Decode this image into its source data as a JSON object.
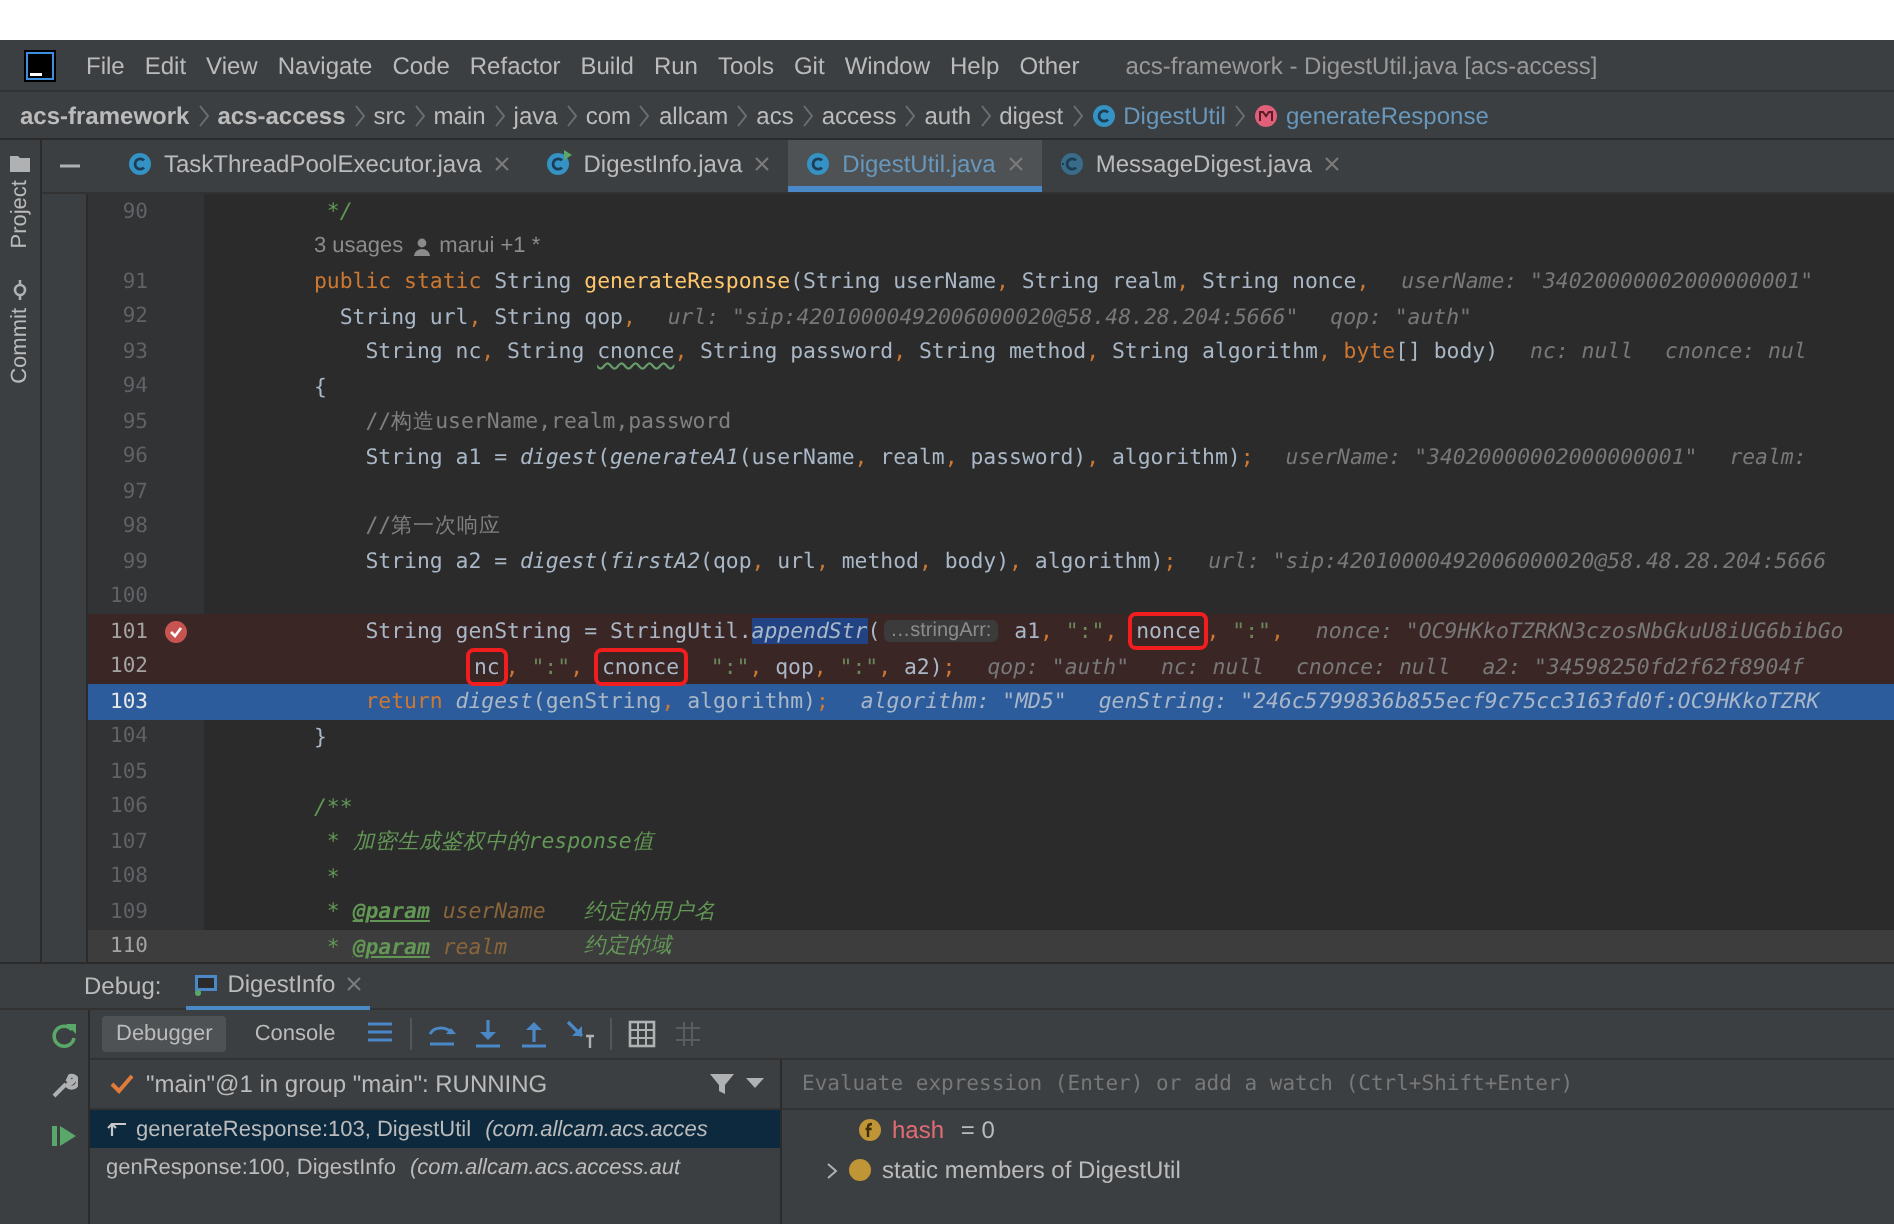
{
  "menu_bar": {
    "items": [
      "File",
      "Edit",
      "View",
      "Navigate",
      "Code",
      "Refactor",
      "Build",
      "Run",
      "Tools",
      "Git",
      "Window",
      "Help",
      "Other"
    ],
    "title": "acs-framework - DigestUtil.java [acs-access]"
  },
  "breadcrumb": [
    {
      "label": "acs-framework",
      "kind": "project"
    },
    {
      "label": "acs-access",
      "kind": "project"
    },
    {
      "label": "src",
      "kind": "folder"
    },
    {
      "label": "main",
      "kind": "folder"
    },
    {
      "label": "java",
      "kind": "folder"
    },
    {
      "label": "com",
      "kind": "folder"
    },
    {
      "label": "allcam",
      "kind": "folder"
    },
    {
      "label": "acs",
      "kind": "folder"
    },
    {
      "label": "access",
      "kind": "folder"
    },
    {
      "label": "auth",
      "kind": "folder"
    },
    {
      "label": "digest",
      "kind": "folder"
    },
    {
      "label": "DigestUtil",
      "kind": "class"
    },
    {
      "label": "generateResponse",
      "kind": "method"
    }
  ],
  "side_tools": [
    {
      "label": "Project",
      "kind": "project"
    },
    {
      "label": "Commit",
      "kind": "commit"
    }
  ],
  "editor_tabs": [
    {
      "label": "TaskThreadPoolExecutor.java",
      "kind": "class",
      "selected": false
    },
    {
      "label": "DigestInfo.java",
      "kind": "running",
      "selected": false
    },
    {
      "label": "DigestUtil.java",
      "kind": "class",
      "selected": true
    },
    {
      "label": "MessageDigest.java",
      "kind": "abstract",
      "selected": false
    }
  ],
  "code_lines": [
    {
      "kind": "code",
      "number": "90",
      "in_breakpoint": false,
      "stopped": false,
      "caret": false,
      "breakpoint": false,
      "tokens": [
        {
          "t": " */",
          "kind": "doc"
        }
      ]
    },
    {
      "kind": "inlay",
      "usages": "3 usages",
      "author": "marui +1 *"
    },
    {
      "kind": "code",
      "number": "91",
      "in_breakpoint": false,
      "stopped": false,
      "caret": false,
      "breakpoint": false,
      "tokens": [
        {
          "t": "public static ",
          "kind": "kw"
        },
        {
          "t": "String ",
          "kind": "p"
        },
        {
          "t": "generateResponse",
          "kind": "fn"
        },
        {
          "t": "(String userName",
          "kind": "p"
        },
        {
          "t": ",",
          "kind": "kw"
        },
        {
          "t": " String realm",
          "kind": "p"
        },
        {
          "t": ",",
          "kind": "kw"
        },
        {
          "t": " String nonce",
          "kind": "p"
        },
        {
          "t": ",",
          "kind": "kw"
        },
        {
          "t": "userName: \"34020000002000000001\"",
          "kind": "hint"
        }
      ]
    },
    {
      "kind": "code",
      "number": "92",
      "in_breakpoint": false,
      "stopped": false,
      "caret": false,
      "breakpoint": false,
      "tokens": [
        {
          "t": "  String url",
          "kind": "p"
        },
        {
          "t": ",",
          "kind": "kw"
        },
        {
          "t": " String qop",
          "kind": "p"
        },
        {
          "t": ",",
          "kind": "kw"
        },
        {
          "t": "url: \"sip:42010000492006000020@58.48.28.204:5666\"",
          "kind": "hint"
        },
        {
          "t": "qop: \"auth\"",
          "kind": "hint"
        }
      ]
    },
    {
      "kind": "code",
      "number": "93",
      "in_breakpoint": false,
      "stopped": false,
      "caret": false,
      "breakpoint": false,
      "tokens": [
        {
          "t": "    String nc",
          "kind": "p"
        },
        {
          "t": ",",
          "kind": "kw"
        },
        {
          "t": " String ",
          "kind": "p"
        },
        {
          "t": "cnonce",
          "kind": "typo"
        },
        {
          "t": ",",
          "kind": "kw"
        },
        {
          "t": " String password",
          "kind": "p"
        },
        {
          "t": ",",
          "kind": "kw"
        },
        {
          "t": " String method",
          "kind": "p"
        },
        {
          "t": ",",
          "kind": "kw"
        },
        {
          "t": " String algorithm",
          "kind": "p"
        },
        {
          "t": ",",
          "kind": "kw"
        },
        {
          "t": " byte",
          "kind": "kw"
        },
        {
          "t": "[] body)",
          "kind": "p"
        },
        {
          "t": "nc: null",
          "kind": "hint"
        },
        {
          "t": "cnonce: nul",
          "kind": "hint"
        }
      ]
    },
    {
      "kind": "code",
      "number": "94",
      "in_breakpoint": false,
      "stopped": false,
      "caret": false,
      "breakpoint": false,
      "tokens": [
        {
          "t": "{",
          "kind": "p"
        }
      ]
    },
    {
      "kind": "code",
      "number": "95",
      "in_breakpoint": false,
      "stopped": false,
      "caret": false,
      "breakpoint": false,
      "tokens": [
        {
          "t": "    //构造userName,realm,password",
          "kind": "cm"
        }
      ]
    },
    {
      "kind": "code",
      "number": "96",
      "in_breakpoint": false,
      "stopped": false,
      "caret": false,
      "breakpoint": false,
      "tokens": [
        {
          "t": "    String a1 = ",
          "kind": "p"
        },
        {
          "t": "digest",
          "kind": "it"
        },
        {
          "t": "(",
          "kind": "p"
        },
        {
          "t": "generateA1",
          "kind": "it"
        },
        {
          "t": "(userName",
          "kind": "p"
        },
        {
          "t": ",",
          "kind": "kw"
        },
        {
          "t": " realm",
          "kind": "p"
        },
        {
          "t": ",",
          "kind": "kw"
        },
        {
          "t": " password)",
          "kind": "p"
        },
        {
          "t": ",",
          "kind": "kw"
        },
        {
          "t": " algorithm)",
          "kind": "p"
        },
        {
          "t": ";",
          "kind": "kw"
        },
        {
          "t": "userName: \"34020000002000000001\"",
          "kind": "hint"
        },
        {
          "t": "realm:",
          "kind": "hint"
        }
      ]
    },
    {
      "kind": "code",
      "number": "97",
      "in_breakpoint": false,
      "stopped": false,
      "caret": false,
      "breakpoint": false
    },
    {
      "kind": "code",
      "number": "98",
      "in_breakpoint": false,
      "stopped": false,
      "caret": false,
      "breakpoint": false,
      "tokens": [
        {
          "t": "    //第一次响应",
          "kind": "cm"
        }
      ]
    },
    {
      "kind": "code",
      "number": "99",
      "in_breakpoint": false,
      "stopped": false,
      "caret": false,
      "breakpoint": false,
      "tokens": [
        {
          "t": "    String a2 = ",
          "kind": "p"
        },
        {
          "t": "digest",
          "kind": "it"
        },
        {
          "t": "(",
          "kind": "p"
        },
        {
          "t": "firstA2",
          "kind": "it"
        },
        {
          "t": "(qop",
          "kind": "p"
        },
        {
          "t": ",",
          "kind": "kw"
        },
        {
          "t": " url",
          "kind": "p"
        },
        {
          "t": ",",
          "kind": "kw"
        },
        {
          "t": " method",
          "kind": "p"
        },
        {
          "t": ",",
          "kind": "kw"
        },
        {
          "t": " body)",
          "kind": "p"
        },
        {
          "t": ",",
          "kind": "kw"
        },
        {
          "t": " algorithm)",
          "kind": "p"
        },
        {
          "t": ";",
          "kind": "kw"
        },
        {
          "t": "url: \"sip:42010000492006000020@58.48.28.204:5666",
          "kind": "hint"
        }
      ]
    },
    {
      "kind": "code",
      "number": "100",
      "in_breakpoint": false,
      "stopped": false,
      "caret": false,
      "breakpoint": false
    },
    {
      "kind": "code",
      "number": "101",
      "in_breakpoint": true,
      "stopped": false,
      "caret": false,
      "breakpoint": true,
      "tokens": [
        {
          "t": "    String genString = StringUtil.",
          "kind": "p"
        },
        {
          "t": "appendStr",
          "kind": "sel"
        },
        {
          "t": "(",
          "kind": "p"
        },
        {
          "t": "…stringArr:",
          "kind": "phint"
        },
        {
          "t": " a1",
          "kind": "p"
        },
        {
          "t": ",",
          "kind": "kw"
        },
        {
          "t": " \":\"",
          "kind": "str"
        },
        {
          "t": ", ",
          "kind": "kw"
        },
        {
          "t": "nonce",
          "kind": "p",
          "boxed": true
        },
        {
          "t": ",",
          "kind": "kw"
        },
        {
          "t": " \":\"",
          "kind": "str"
        },
        {
          "t": ",",
          "kind": "kw"
        },
        {
          "t": "nonce: \"OC9HKkoTZRKN3czosNbGkuU8iUG6bibGo",
          "kind": "hint"
        }
      ]
    },
    {
      "kind": "wrap",
      "number": "102",
      "in_breakpoint": true,
      "stopped": false,
      "caret": false,
      "breakpoint": false,
      "tokens": [
        {
          "t": "nc",
          "kind": "p",
          "boxed": true
        },
        {
          "t": ",",
          "kind": "kw"
        },
        {
          "t": " \":\"",
          "kind": "str"
        },
        {
          "t": ", ",
          "kind": "kw"
        },
        {
          "t": "cnonce",
          "kind": "p",
          "boxed": true
        },
        {
          "t": "  \":\"",
          "kind": "str"
        },
        {
          "t": ",",
          "kind": "kw"
        },
        {
          "t": " qop",
          "kind": "p"
        },
        {
          "t": ",",
          "kind": "kw"
        },
        {
          "t": " \":\"",
          "kind": "str"
        },
        {
          "t": ",",
          "kind": "kw"
        },
        {
          "t": " a2)",
          "kind": "p"
        },
        {
          "t": ";",
          "kind": "kw"
        },
        {
          "t": "qop: \"auth\"",
          "kind": "hint"
        },
        {
          "t": "nc: null",
          "kind": "hint"
        },
        {
          "t": "cnonce: null",
          "kind": "hint"
        },
        {
          "t": "a2: \"34598250fd2f62f8904f",
          "kind": "hint"
        }
      ]
    },
    {
      "kind": "code",
      "number": "103",
      "in_breakpoint": false,
      "stopped": true,
      "caret": false,
      "breakpoint": false,
      "tokens": [
        {
          "t": "    return ",
          "kind": "kw"
        },
        {
          "t": "digest",
          "kind": "it"
        },
        {
          "t": "(genString",
          "kind": "p"
        },
        {
          "t": ",",
          "kind": "kw"
        },
        {
          "t": " algorithm)",
          "kind": "p"
        },
        {
          "t": ";",
          "kind": "kw"
        },
        {
          "t": "algorithm: \"MD5\"",
          "kind": "hint"
        },
        {
          "t": "genString: \"246c5799836b855ecf9c75cc3163fd0f:OC9HKkoTZRK",
          "kind": "hint"
        }
      ]
    },
    {
      "kind": "code",
      "number": "104",
      "in_breakpoint": false,
      "stopped": false,
      "caret": false,
      "breakpoint": false,
      "tokens": [
        {
          "t": "}",
          "kind": "p"
        }
      ]
    },
    {
      "kind": "code",
      "number": "105",
      "in_breakpoint": false,
      "stopped": false,
      "caret": false,
      "breakpoint": false
    },
    {
      "kind": "code",
      "number": "106",
      "in_breakpoint": false,
      "stopped": false,
      "caret": false,
      "breakpoint": false,
      "tokens": [
        {
          "t": "/**",
          "kind": "doc"
        }
      ]
    },
    {
      "kind": "code",
      "number": "107",
      "in_breakpoint": false,
      "stopped": false,
      "caret": false,
      "breakpoint": false,
      "tokens": [
        {
          "t": " * 加密生成鉴权中的response值",
          "kind": "doc"
        }
      ]
    },
    {
      "kind": "code",
      "number": "108",
      "in_breakpoint": false,
      "stopped": false,
      "caret": false,
      "breakpoint": false,
      "tokens": [
        {
          "t": " *",
          "kind": "doc"
        }
      ]
    },
    {
      "kind": "code",
      "number": "109",
      "in_breakpoint": false,
      "stopped": false,
      "caret": false,
      "breakpoint": false,
      "tokens": [
        {
          "t": " * ",
          "kind": "doc"
        },
        {
          "t": "@param",
          "kind": "tag"
        },
        {
          "t": " userName",
          "kind": "dp"
        },
        {
          "t": "   约定的用户名",
          "kind": "doc"
        }
      ]
    },
    {
      "kind": "code",
      "number": "110",
      "in_breakpoint": false,
      "stopped": false,
      "caret": true,
      "breakpoint": false,
      "tokens": [
        {
          "t": " * ",
          "kind": "doc"
        },
        {
          "t": "@param",
          "kind": "tag"
        },
        {
          "t": " realm",
          "kind": "dp"
        },
        {
          "t": "      约定的域",
          "kind": "doc"
        }
      ]
    }
  ],
  "debug": {
    "label": "Debug:",
    "session_tab": "DigestInfo",
    "tabs": [
      {
        "label": "Debugger",
        "selected": true
      },
      {
        "label": "Console",
        "selected": false
      }
    ],
    "thread": "\"main\"@1 in group \"main\": RUNNING",
    "evaluate": {
      "placeholder": "Evaluate expression (Enter) or add a watch (Ctrl+Shift+Enter)"
    },
    "frames": [
      {
        "method": "generateResponse:103, DigestUtil",
        "package": "(com.allcam.acs.acces",
        "selected": true
      },
      {
        "method": "genResponse:100, DigestInfo",
        "package": "(com.allcam.acs.access.aut",
        "selected": false
      }
    ],
    "variables": [
      {
        "kind": "field",
        "name": "hash",
        "value": " = 0"
      },
      {
        "kind": "static",
        "name": "static members of DigestUtil"
      }
    ]
  }
}
